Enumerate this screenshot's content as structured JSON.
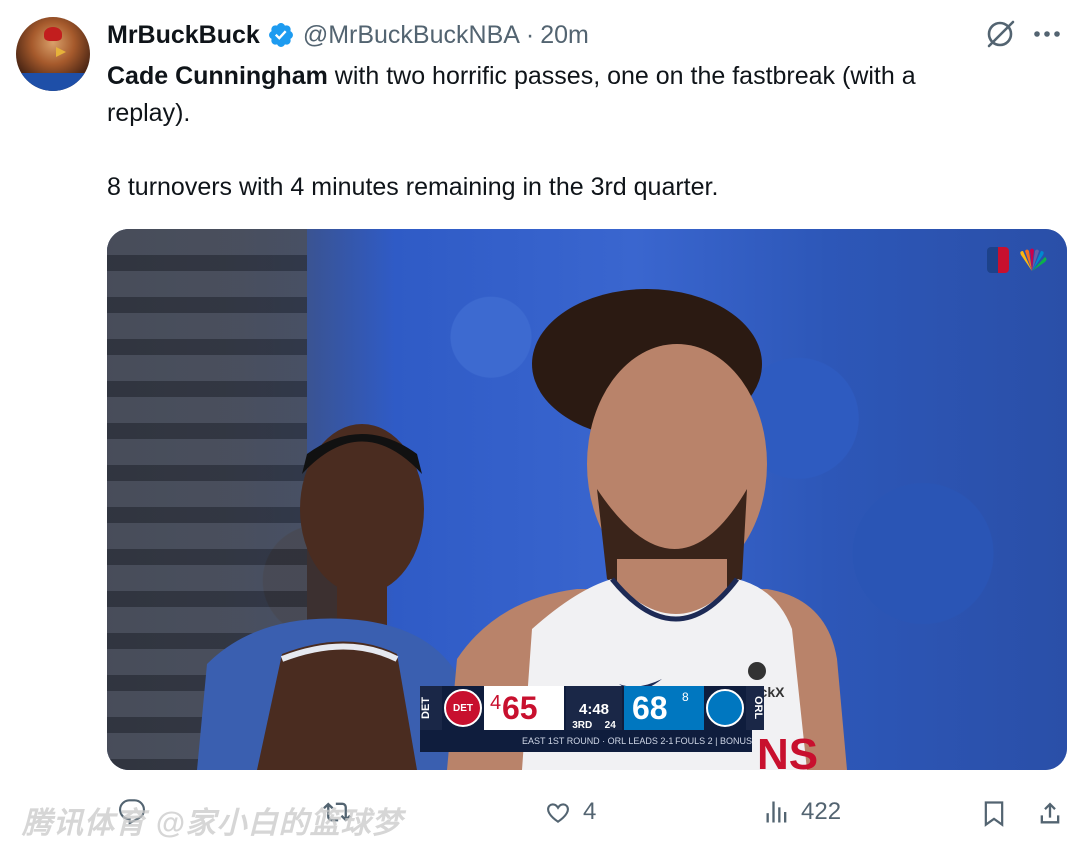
{
  "tweet": {
    "author_name": "MrBuckBuck",
    "handle": "@MrBuckBuckNBA",
    "separator": "·",
    "time": "20m",
    "text_bold": "Cade Cunningham",
    "text_line1_rest": " with two horrific passes, one on the fastbreak (with a",
    "text_line2": "replay).",
    "text_line3": "8 turnovers with 4 minutes remaining in the 3rd quarter."
  },
  "media": {
    "scorebug": {
      "home_abbr": "DET",
      "home_logo_text": "DET",
      "home_score": "65",
      "home_timeouts": "4",
      "clock": "4:48",
      "period": "3RD",
      "shot_clock": "24",
      "away_score": "68",
      "away_timeouts": "8",
      "away_abbr": "ORL",
      "bottom_left": "EAST 1ST ROUND · ORL LEADS 2-1",
      "bottom_right": "FOULS 2 | BONUS"
    },
    "jersey_sponsor": "StockX"
  },
  "actions": {
    "likes": "4",
    "views": "422"
  },
  "watermark": "腾讯体育 @家小白的篮球梦",
  "colors": {
    "verified": "#1d9bf0",
    "text_secondary": "#536471",
    "pistons_red": "#c8102e",
    "magic_blue": "#0077c0"
  },
  "icons": [
    "verified-icon",
    "grok-icon",
    "more-icon",
    "nba-logo",
    "peacock-logo",
    "like-icon",
    "views-icon",
    "bookmark-icon",
    "share-icon"
  ]
}
